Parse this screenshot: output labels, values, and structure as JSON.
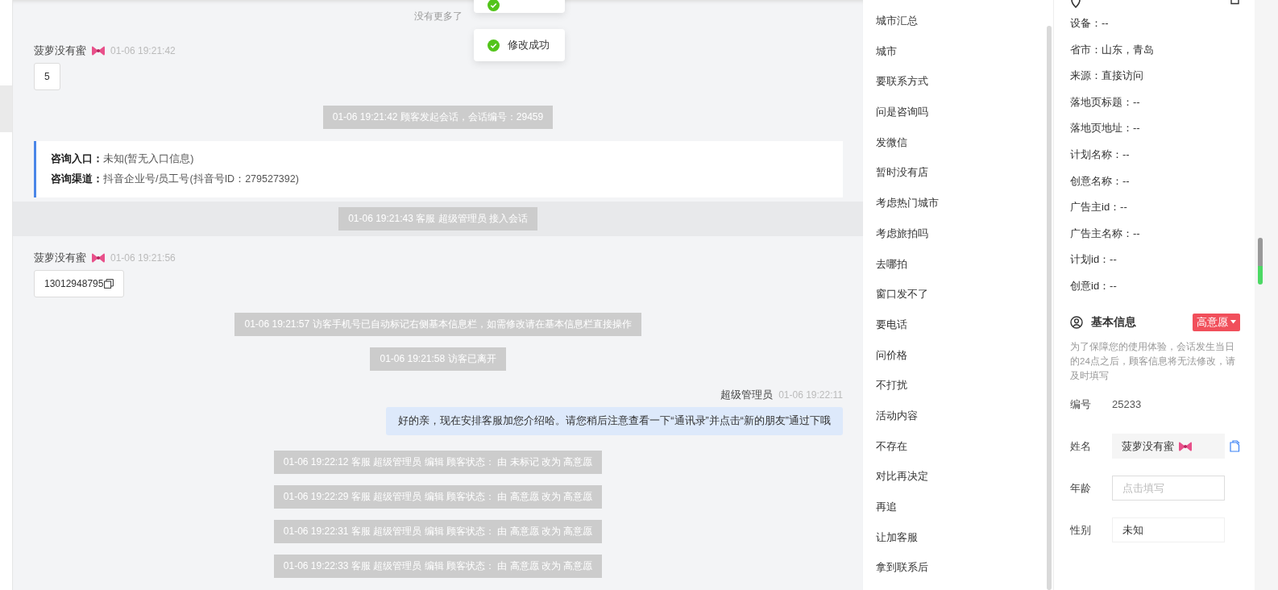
{
  "toasts": [
    {
      "kind": "clipped"
    },
    {
      "kind": "full",
      "text": "修改成功"
    }
  ],
  "chat": {
    "items": [
      {
        "kind": "notice",
        "text": "没有更多了"
      },
      {
        "kind": "visitor",
        "name": "菠萝没有蜜",
        "time": "01-06 19:21:42",
        "text": "5",
        "copyable": false
      },
      {
        "kind": "system",
        "text": "01-06 19:21:42 顾客发起会话，会话编号：29459"
      },
      {
        "kind": "entry",
        "lines": [
          {
            "label": "咨询入口：",
            "value": "未知(暂无入口信息)"
          },
          {
            "label": "咨询渠道：",
            "value": "抖音企业号/员工号(抖音号ID：279527392)"
          }
        ]
      },
      {
        "kind": "band",
        "text": "01-06 19:21:43 客服 超级管理员 接入会话"
      },
      {
        "kind": "visitor",
        "name": "菠萝没有蜜",
        "time": "01-06 19:21:56",
        "text": "13012948795",
        "copyable": true
      },
      {
        "kind": "system",
        "text": "01-06 19:21:57 访客手机号已自动标记右侧基本信息栏，如需修改请在基本信息栏直接操作"
      },
      {
        "kind": "system",
        "text": "01-06 19:21:58 访客已离开"
      },
      {
        "kind": "agent",
        "name": "超级管理员",
        "time": "01-06 19:22:11",
        "text": "好的亲，现在安排客服加您介绍哈。请您稍后注意查看一下“通讯录”并点击“新的朋友”通过下哦"
      },
      {
        "kind": "system",
        "text": "01-06 19:22:12 客服 超级管理员 编辑 顾客状态： 由 未标记 改为 高意愿"
      },
      {
        "kind": "system",
        "text": "01-06 19:22:29 客服 超级管理员 编辑 顾客状态： 由 高意愿 改为 高意愿"
      },
      {
        "kind": "system",
        "text": "01-06 19:22:31 客服 超级管理员 编辑 顾客状态： 由 高意愿 改为 高意愿"
      },
      {
        "kind": "system",
        "text": "01-06 19:22:33 客服 超级管理员 编辑 顾客状态： 由 高意愿 改为 高意愿"
      }
    ]
  },
  "quick_replies": [
    "城市汇总",
    "城市",
    "要联系方式",
    "问是咨询吗",
    "发微信",
    "暂时没有店",
    "考虑热门城市",
    "考虑旅拍吗",
    "去哪拍",
    "窗口发不了",
    "要电话",
    "问价格",
    "不打扰",
    "活动内容",
    "不存在",
    "对比再决定",
    "再追",
    "让加客服",
    "拿到联系后"
  ],
  "source_info": [
    "设备：--",
    "省市：山东，青岛",
    "来源：直接访问",
    "落地页标题：--",
    "落地页地址：--",
    "计划名称：--",
    "创意名称：--",
    "广告主id：--",
    "广告主名称：--",
    "计划id：--",
    "创意id：--"
  ],
  "basic_info": {
    "title": "基本信息",
    "status": "高意愿",
    "note": "为了保障您的使用体验，会话发生当日的24点之后，顾客信息将无法修改，请及时填写",
    "fields": [
      {
        "kind": "text",
        "label": "编号",
        "value": "25233"
      },
      {
        "kind": "name",
        "label": "姓名",
        "value": "菠萝没有蜜"
      },
      {
        "kind": "input",
        "label": "年龄",
        "placeholder": "点击填写"
      },
      {
        "kind": "select",
        "label": "性别",
        "value": "未知"
      }
    ]
  }
}
